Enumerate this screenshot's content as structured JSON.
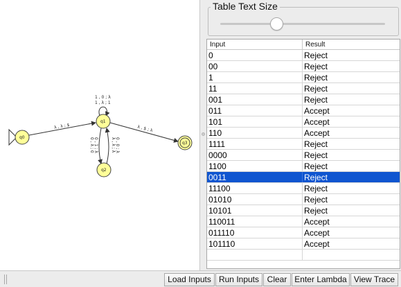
{
  "canvas": {
    "states": [
      {
        "id": "q0",
        "label": "q0",
        "initial": true,
        "final": false
      },
      {
        "id": "q1",
        "label": "q1",
        "initial": false,
        "final": false
      },
      {
        "id": "q2",
        "label": "q2",
        "initial": false,
        "final": false
      },
      {
        "id": "q3",
        "label": "q3",
        "initial": false,
        "final": true
      }
    ],
    "transitions": {
      "q0_q1": "λ , λ ; $",
      "q1_loop_1": "1 , 0 ; λ",
      "q1_loop_2": "1 , λ ; 1",
      "q1_q3": "λ , $ ; λ",
      "q1_q2_a": "0 , λ ; 0",
      "q1_q2_b": "0 , 1 ; λ",
      "q2_q1_a": "λ , λ ; λ",
      "q2_q1_b": "0 , 0 ; λ"
    },
    "state_fill": "#ffff99",
    "state_stroke": "#444444"
  },
  "table_text_size": {
    "title": "Table Text Size",
    "slider_value": 0.34
  },
  "table": {
    "columns": [
      "Input",
      "Result"
    ],
    "rows": [
      {
        "input": "0",
        "result": "Reject"
      },
      {
        "input": "00",
        "result": "Reject"
      },
      {
        "input": "1",
        "result": "Reject"
      },
      {
        "input": "11",
        "result": "Reject"
      },
      {
        "input": "001",
        "result": "Reject"
      },
      {
        "input": "011",
        "result": "Accept"
      },
      {
        "input": "101",
        "result": "Accept"
      },
      {
        "input": "110",
        "result": "Accept"
      },
      {
        "input": "1111",
        "result": "Reject"
      },
      {
        "input": "0000",
        "result": "Reject"
      },
      {
        "input": "1100",
        "result": "Reject"
      },
      {
        "input": "0011",
        "result": "Reject"
      },
      {
        "input": "11100",
        "result": "Reject"
      },
      {
        "input": "01010",
        "result": "Reject"
      },
      {
        "input": "10101",
        "result": "Reject"
      },
      {
        "input": "110011",
        "result": "Accept"
      },
      {
        "input": "011110",
        "result": "Accept"
      },
      {
        "input": "101110",
        "result": "Accept"
      },
      {
        "input": "",
        "result": ""
      }
    ],
    "selected_row": 11,
    "selection_color": "#0f55d0"
  },
  "toolbar": {
    "load_inputs": "Load Inputs",
    "run_inputs": "Run Inputs",
    "clear": "Clear",
    "enter_lambda": "Enter Lambda",
    "view_trace": "View Trace"
  }
}
